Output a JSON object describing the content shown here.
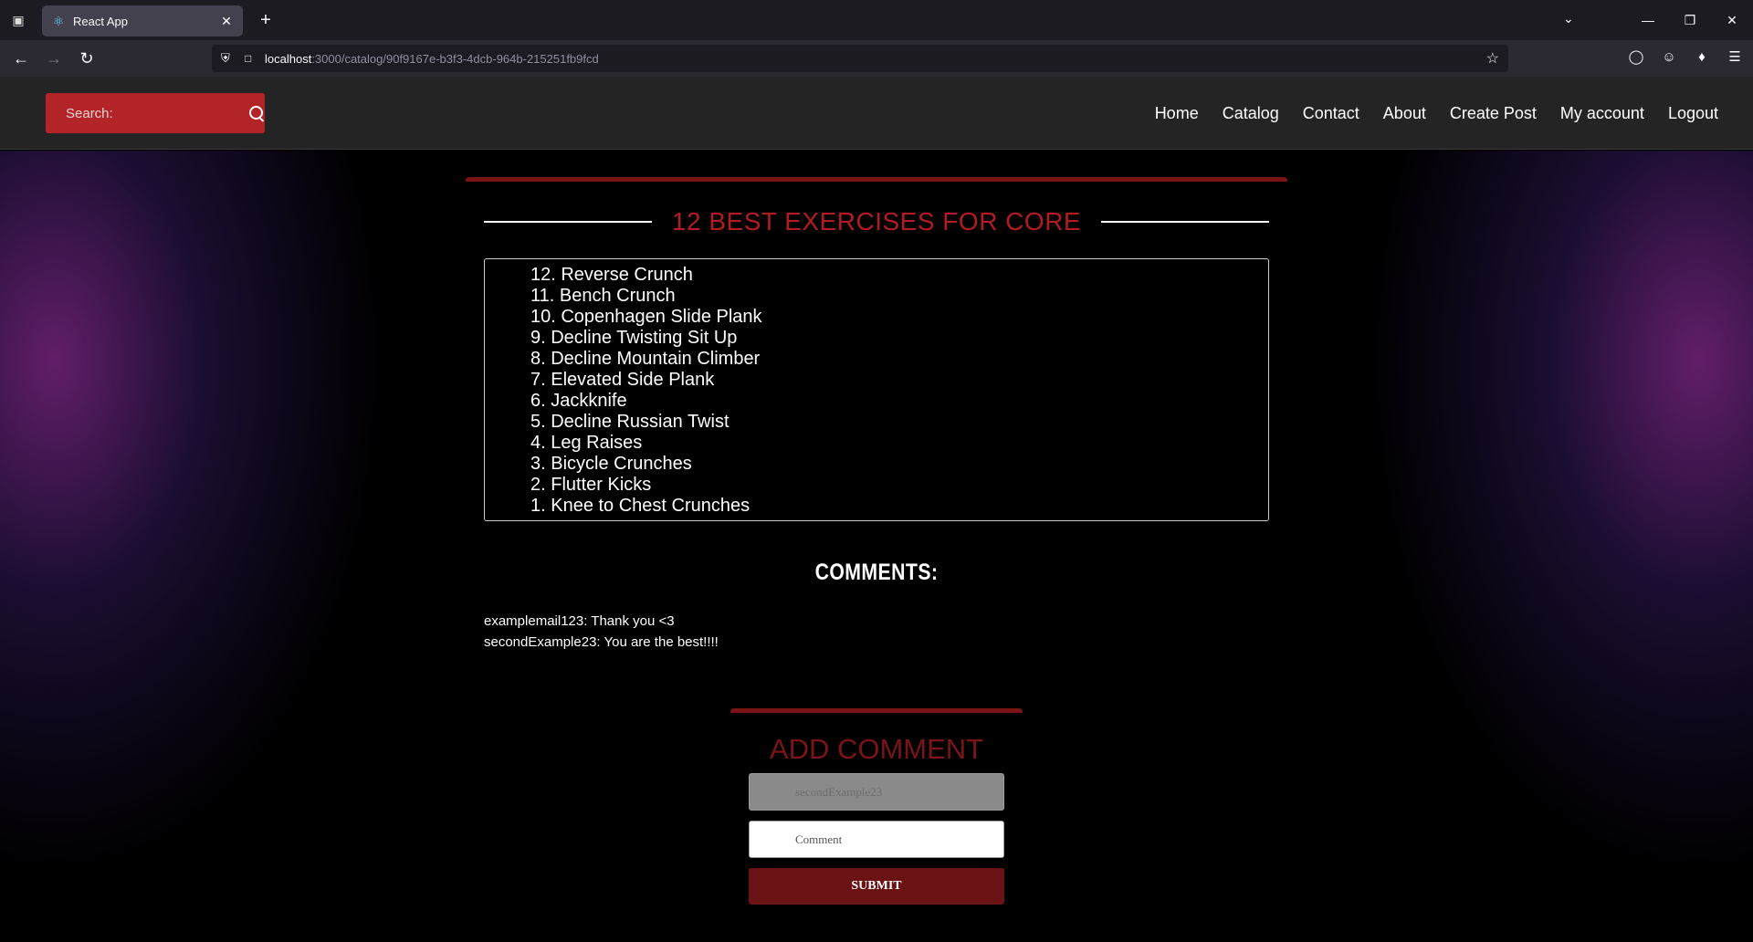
{
  "browser": {
    "tab_title": "React App",
    "url_host": "localhost",
    "url_rest": ":3000/catalog/90f9167e-b3f3-4dcb-964b-215251fb9fcd"
  },
  "header": {
    "search_placeholder": "Search:",
    "nav": [
      "Home",
      "Catalog",
      "Contact",
      "About",
      "Create Post",
      "My account",
      "Logout"
    ]
  },
  "post": {
    "title": "12 BEST EXERCISES FOR CORE",
    "items": [
      "12. Reverse Crunch",
      "11. Bench Crunch",
      "10. Copenhagen Slide Plank",
      "9. Decline Twisting Sit Up",
      "8. Decline Mountain Climber",
      "7. Elevated Side Plank",
      "6. Jackknife",
      "5. Decline Russian Twist",
      "4. Leg Raises",
      "3. Bicycle Crunches",
      "2. Flutter Kicks",
      "1. Knee to Chest Crunches"
    ]
  },
  "comments": {
    "heading": "COMMENTS:",
    "list": [
      "examplemail123: Thank you <3",
      "secondExample23: You are the best!!!!"
    ]
  },
  "form": {
    "heading": "ADD COMMENT",
    "username_value": "secondExample23",
    "comment_placeholder": "Comment",
    "submit_label": "SUBMIT"
  },
  "colors": {
    "accent_red": "#b22428",
    "title_red": "#b01c22",
    "dark_red": "#6b1214"
  }
}
